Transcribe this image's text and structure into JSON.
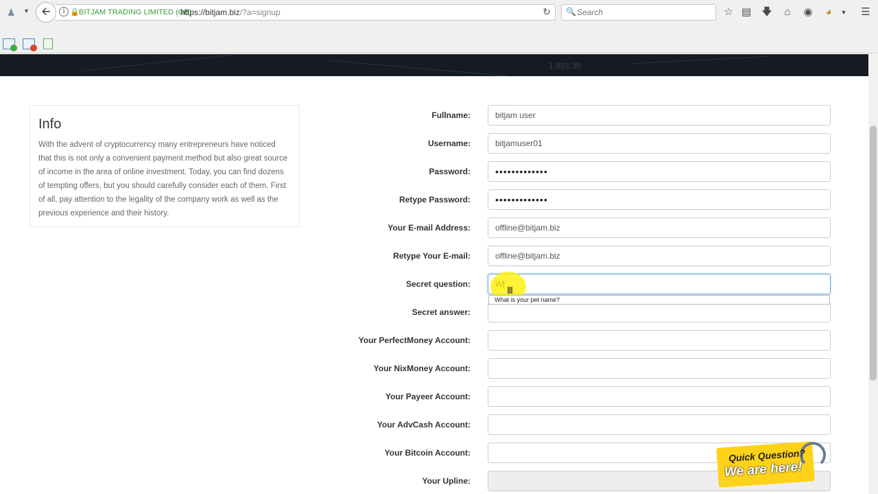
{
  "browser": {
    "identity": "BITJAM TRADING LIMITED (GB)",
    "url_domain": "https://bitjam.biz",
    "url_path": "/?a=signup",
    "search_placeholder": "Search"
  },
  "hero": {
    "number": "1,893,30"
  },
  "info": {
    "title": "Info",
    "text": "With the advent of cryptocurrency many entrepreneurs have noticed that this is not only a convenient payment method but also great source of income in the area of online investment. Today, you can find dozens of tempting offers, but you should carefully consider each of them. First of all, pay attention to the legality of the company work as well as the previous experience and their history."
  },
  "form": {
    "fields": [
      {
        "label": "Fullname:",
        "value": "bitjam user"
      },
      {
        "label": "Username:",
        "value": "bitjamuser01"
      },
      {
        "label": "Password:",
        "value": "•••••••••••••"
      },
      {
        "label": "Retype Password:",
        "value": "•••••••••••••"
      },
      {
        "label": "Your E-mail Address:",
        "value": "offline@bitjam.biz"
      },
      {
        "label": "Retype Your E-mail:",
        "value": "offline@bitjam.biz"
      },
      {
        "label": "Secret question:",
        "value": "W"
      },
      {
        "label": "Secret answer:",
        "value": ""
      },
      {
        "label": "Your PerfectMoney Account:",
        "value": ""
      },
      {
        "label": "Your NixMoney Account:",
        "value": ""
      },
      {
        "label": "Your Payeer Account:",
        "value": ""
      },
      {
        "label": "Your AdvCash Account:",
        "value": ""
      },
      {
        "label": "Your Bitcoin Account:",
        "value": ""
      },
      {
        "label": "Your Upline:",
        "value": ""
      }
    ],
    "autocomplete_suggestion": "What is your pet name?"
  },
  "badge": {
    "line1": "Quick Question?",
    "line2": "We are here!"
  }
}
